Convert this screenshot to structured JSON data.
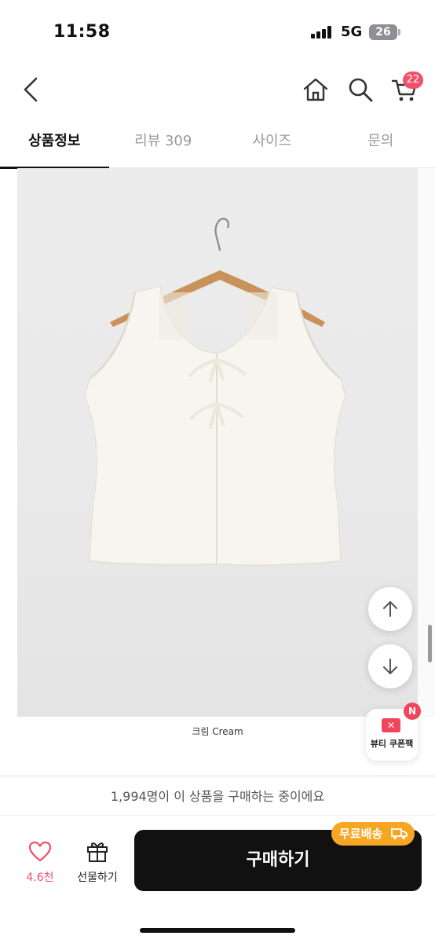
{
  "status_bar": {
    "time": "11:58",
    "network": "5G",
    "battery": "26"
  },
  "nav": {
    "cart_count": "22"
  },
  "tabs": [
    {
      "label": "상품정보",
      "active": true
    },
    {
      "label": "리뷰 309",
      "active": false
    },
    {
      "label": "사이즈",
      "active": false
    },
    {
      "label": "문의",
      "active": false
    }
  ],
  "product": {
    "caption": "크림  Cream"
  },
  "floating": {
    "coupon_label": "뷰티 쿠폰팩",
    "coupon_badge": "N"
  },
  "bottom": {
    "buyers_text": "1,994명이 이 상품을 구매하는 중이에요",
    "like_count": "4.6천",
    "gift_label": "선물하기",
    "buy_label": "구매하기",
    "free_shipping": "무료배송"
  },
  "colors": {
    "accent": "#f0526a",
    "free_ship": "#f6a623",
    "buy_button": "#111111"
  }
}
